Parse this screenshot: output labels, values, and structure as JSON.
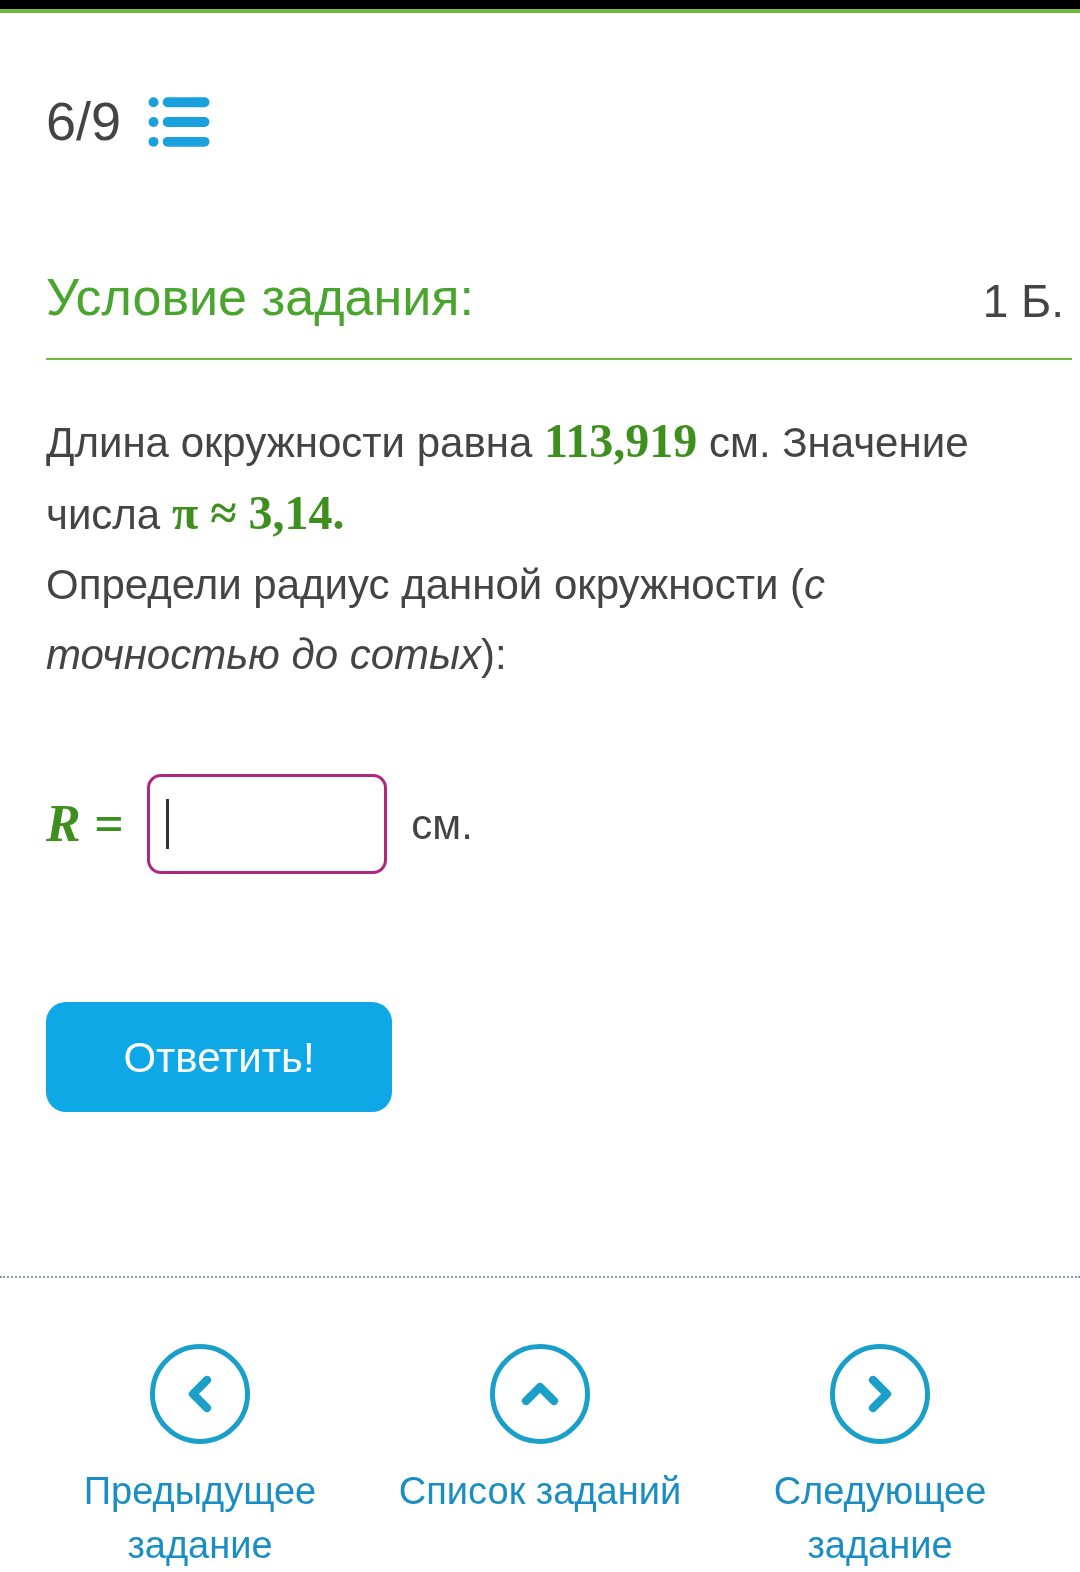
{
  "progress": {
    "counter": "6/9"
  },
  "task": {
    "heading": "Условие задания:",
    "points": "1 Б."
  },
  "statement": [
    "Длина окружности равна **113,919** см. Значение числа **π ≈ 3,14.**",
    "Определи радиус данной окружности (*с точностью до сотых*):"
  ],
  "answer": {
    "label": "R =",
    "unit": "см.",
    "focused": true
  },
  "submit": "Ответить!",
  "nav": [
    {
      "kind": "prev",
      "label": "Предыдущее задание"
    },
    {
      "kind": "list",
      "label": "Список заданий"
    },
    {
      "kind": "next",
      "label": "Следующее задание"
    }
  ]
}
